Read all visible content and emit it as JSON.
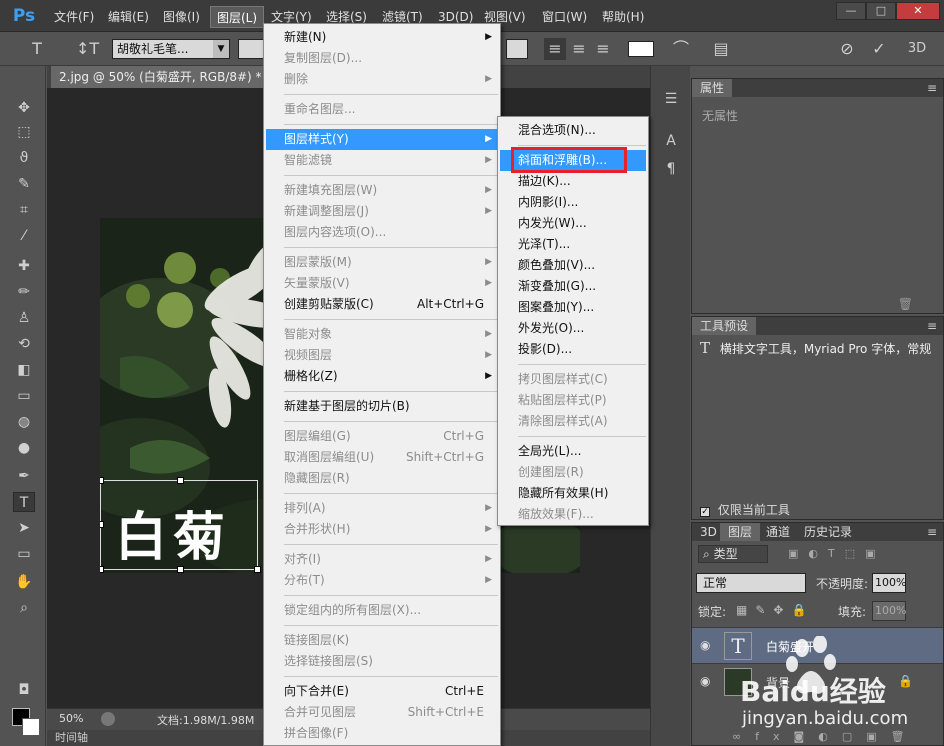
{
  "app": {
    "logo": "Ps"
  },
  "menubar": {
    "items": [
      "文件(F)",
      "编辑(E)",
      "图像(I)",
      "图层(L)",
      "文字(Y)",
      "选择(S)",
      "滤镜(T)",
      "3D(D)",
      "视图(V)",
      "窗口(W)",
      "帮助(H)"
    ],
    "active_index": 3,
    "window_buttons": [
      "—",
      "□",
      "✕"
    ]
  },
  "options": {
    "font_family": "胡敬礼毛笔...",
    "mode_3d": "3D"
  },
  "document": {
    "tab_title": "2.jpg @ 50% (白菊盛开, RGB/8#) *",
    "zoom": "50%",
    "doc_info": "文档:1.98M/1.98M",
    "calligraphy_text": "白菊",
    "timeline_label": "时间轴"
  },
  "layer_menu": {
    "items": [
      {
        "label": "新建(N)",
        "disabled": false,
        "submenu": true,
        "shortcut": ""
      },
      {
        "label": "复制图层(D)...",
        "disabled": true,
        "submenu": false,
        "shortcut": ""
      },
      {
        "label": "删除",
        "disabled": true,
        "submenu": true,
        "shortcut": ""
      },
      {
        "label": "重命名图层...",
        "disabled": true,
        "submenu": false,
        "shortcut": ""
      },
      {
        "label": "图层样式(Y)",
        "disabled": false,
        "submenu": true,
        "shortcut": "",
        "highlight": true
      },
      {
        "label": "智能滤镜",
        "disabled": true,
        "submenu": true,
        "shortcut": ""
      },
      {
        "label": "新建填充图层(W)",
        "disabled": true,
        "submenu": true,
        "shortcut": ""
      },
      {
        "label": "新建调整图层(J)",
        "disabled": true,
        "submenu": true,
        "shortcut": ""
      },
      {
        "label": "图层内容选项(O)...",
        "disabled": true,
        "submenu": false,
        "shortcut": ""
      },
      {
        "label": "图层蒙版(M)",
        "disabled": true,
        "submenu": true,
        "shortcut": ""
      },
      {
        "label": "矢量蒙版(V)",
        "disabled": true,
        "submenu": true,
        "shortcut": ""
      },
      {
        "label": "创建剪贴蒙版(C)",
        "disabled": false,
        "submenu": false,
        "shortcut": "Alt+Ctrl+G"
      },
      {
        "label": "智能对象",
        "disabled": true,
        "submenu": true,
        "shortcut": ""
      },
      {
        "label": "视频图层",
        "disabled": true,
        "submenu": true,
        "shortcut": ""
      },
      {
        "label": "栅格化(Z)",
        "disabled": false,
        "submenu": true,
        "shortcut": ""
      },
      {
        "label": "新建基于图层的切片(B)",
        "disabled": false,
        "submenu": false,
        "shortcut": ""
      },
      {
        "label": "图层编组(G)",
        "disabled": true,
        "submenu": false,
        "shortcut": "Ctrl+G"
      },
      {
        "label": "取消图层编组(U)",
        "disabled": true,
        "submenu": false,
        "shortcut": "Shift+Ctrl+G"
      },
      {
        "label": "隐藏图层(R)",
        "disabled": true,
        "submenu": false,
        "shortcut": ""
      },
      {
        "label": "排列(A)",
        "disabled": true,
        "submenu": true,
        "shortcut": ""
      },
      {
        "label": "合并形状(H)",
        "disabled": true,
        "submenu": true,
        "shortcut": ""
      },
      {
        "label": "对齐(I)",
        "disabled": true,
        "submenu": true,
        "shortcut": ""
      },
      {
        "label": "分布(T)",
        "disabled": true,
        "submenu": true,
        "shortcut": ""
      },
      {
        "label": "锁定组内的所有图层(X)...",
        "disabled": true,
        "submenu": false,
        "shortcut": ""
      },
      {
        "label": "链接图层(K)",
        "disabled": true,
        "submenu": false,
        "shortcut": ""
      },
      {
        "label": "选择链接图层(S)",
        "disabled": true,
        "submenu": false,
        "shortcut": ""
      },
      {
        "label": "向下合并(E)",
        "disabled": false,
        "submenu": false,
        "shortcut": "Ctrl+E"
      },
      {
        "label": "合并可见图层",
        "disabled": true,
        "submenu": false,
        "shortcut": "Shift+Ctrl+E"
      },
      {
        "label": "拼合图像(F)",
        "disabled": true,
        "submenu": false,
        "shortcut": ""
      }
    ]
  },
  "style_submenu": {
    "items": [
      {
        "label": "混合选项(N)...",
        "disabled": false
      },
      {
        "label": "斜面和浮雕(B)...",
        "disabled": false,
        "highlight": true
      },
      {
        "label": "描边(K)...",
        "disabled": false
      },
      {
        "label": "内阴影(I)...",
        "disabled": false
      },
      {
        "label": "内发光(W)...",
        "disabled": false
      },
      {
        "label": "光泽(T)...",
        "disabled": false
      },
      {
        "label": "颜色叠加(V)...",
        "disabled": false
      },
      {
        "label": "渐变叠加(G)...",
        "disabled": false
      },
      {
        "label": "图案叠加(Y)...",
        "disabled": false
      },
      {
        "label": "外发光(O)...",
        "disabled": false
      },
      {
        "label": "投影(D)...",
        "disabled": false
      },
      {
        "label": "拷贝图层样式(C)",
        "disabled": true
      },
      {
        "label": "粘贴图层样式(P)",
        "disabled": true
      },
      {
        "label": "清除图层样式(A)",
        "disabled": true
      },
      {
        "label": "全局光(L)...",
        "disabled": false
      },
      {
        "label": "创建图层(R)",
        "disabled": true
      },
      {
        "label": "隐藏所有效果(H)",
        "disabled": false
      },
      {
        "label": "缩放效果(F)...",
        "disabled": true
      }
    ]
  },
  "properties_panel": {
    "tab": "属性",
    "empty_text": "无属性"
  },
  "tool_presets_panel": {
    "tab": "工具预设",
    "preset_text": "横排文字工具，Myriad Pro 字体，常规",
    "current_tool_only": "仅限当前工具"
  },
  "layers_panel": {
    "tabs": [
      "3D",
      "图层",
      "通道",
      "历史记录"
    ],
    "filter_kind": "类型",
    "blend_mode": "正常",
    "opacity_label": "不透明度:",
    "opacity_value": "100%",
    "lock_label": "锁定:",
    "fill_label": "填充:",
    "fill_value": "100%",
    "layers": [
      {
        "name": "白菊盛开",
        "type": "text"
      },
      {
        "name": "背景",
        "type": "image"
      }
    ]
  },
  "watermark": {
    "brand": "Baidu经验",
    "url": "jingyan.baidu.com"
  }
}
